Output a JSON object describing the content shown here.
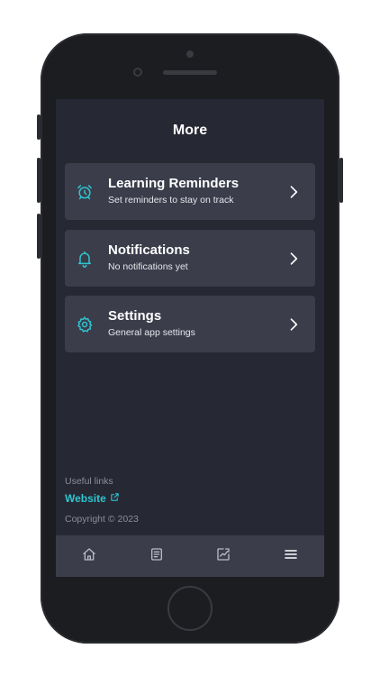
{
  "colors": {
    "accent": "#2fc4cf",
    "background": "#262833",
    "card": "#3b3d4b"
  },
  "header": {
    "title": "More"
  },
  "menu": [
    {
      "title": "Learning Reminders",
      "subtitle": "Set reminders to stay on track",
      "icon": "alarm-clock-icon"
    },
    {
      "title": "Notifications",
      "subtitle": "No notifications yet",
      "icon": "bell-icon"
    },
    {
      "title": "Settings",
      "subtitle": "General app settings",
      "icon": "gear-icon"
    }
  ],
  "footer": {
    "useful_links_label": "Useful links",
    "website_label": "Website",
    "copyright": "Copyright © 2023"
  },
  "tabbar": {
    "items": [
      {
        "icon": "home-icon"
      },
      {
        "icon": "document-icon"
      },
      {
        "icon": "chart-icon"
      },
      {
        "icon": "menu-icon",
        "active": true
      }
    ]
  }
}
